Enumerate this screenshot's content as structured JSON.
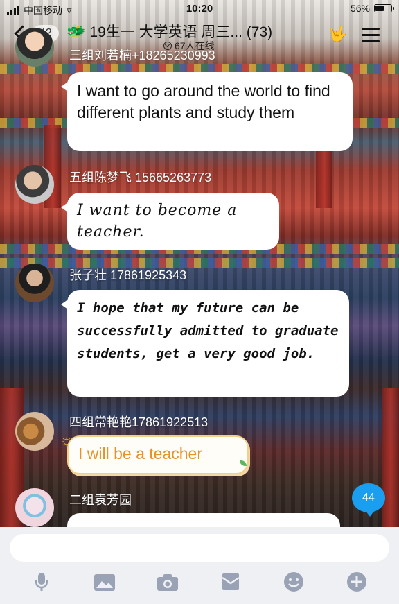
{
  "status_bar": {
    "carrier": "中国移动",
    "time": "10:20",
    "battery_text": "56%",
    "battery_level": 0.56
  },
  "header": {
    "back_count": "42",
    "title": "19生一 大学英语  周三... (73)",
    "online": "67人在线",
    "icons": [
      "chevron-left-icon",
      "group-emoji-icon",
      "hand-gesture-icon",
      "menu-icon"
    ]
  },
  "messages": [
    {
      "sender": "三组刘若楠+18265230993",
      "text": "I want to go around the world to find different plants and study them",
      "style": "plain"
    },
    {
      "sender": "五组陈梦飞  15665263773",
      "text": "I want to become a teacher.",
      "style": "handwriting"
    },
    {
      "sender": "张子壮 17861925343",
      "text": "I hope that my future can be successfully admitted to graduate students, get a very good job.",
      "style": "bold-handwriting"
    },
    {
      "sender": "四组常艳艳17861922513",
      "text": "I will be a teacher",
      "style": "orange-sticker",
      "text_color": "#e8912a"
    },
    {
      "sender": "二组袁芳园",
      "text": "",
      "style": "clipped"
    }
  ],
  "unread_badge": "44",
  "composer": {
    "placeholder": "",
    "tools": [
      "microphone-icon",
      "image-icon",
      "camera-icon",
      "red-packet-icon",
      "emoji-icon",
      "plus-icon"
    ]
  }
}
